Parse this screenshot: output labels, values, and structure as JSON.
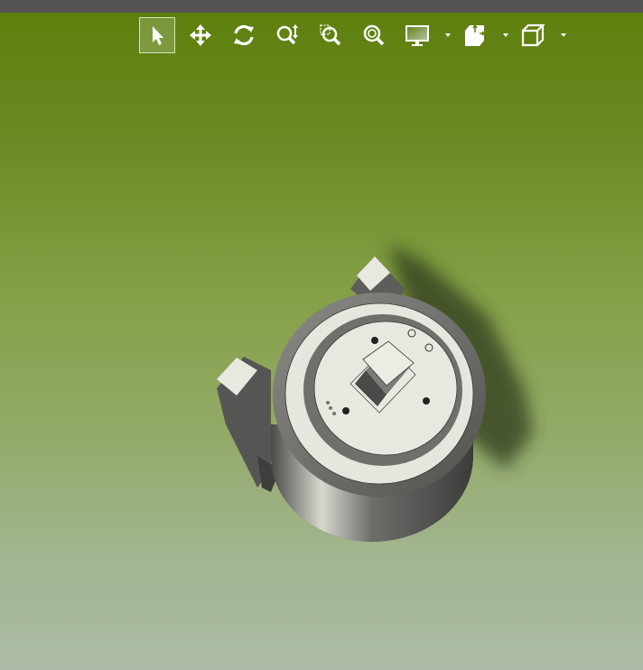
{
  "toolbar": {
    "tools": [
      {
        "icon": "select-arrow-icon",
        "active": true
      },
      {
        "icon": "pan-icon",
        "active": false
      },
      {
        "icon": "rotate-icon",
        "active": false
      },
      {
        "icon": "zoom-icon",
        "active": false
      },
      {
        "icon": "zoom-to-area-icon",
        "active": false
      },
      {
        "icon": "zoom-to-fit-icon",
        "active": false
      },
      {
        "icon": "display-style-icon",
        "active": false,
        "dropdown": true
      },
      {
        "icon": "section-view-icon",
        "active": false,
        "dropdown": true
      },
      {
        "icon": "standard-views-icon",
        "active": false,
        "dropdown": true
      }
    ]
  },
  "colors": {
    "top_bar": "#545454",
    "background_top": "#5d7f0c",
    "background_bottom": "#adbba6",
    "model_light": "#e6e6dc",
    "model_dark": "#5a5a58"
  }
}
